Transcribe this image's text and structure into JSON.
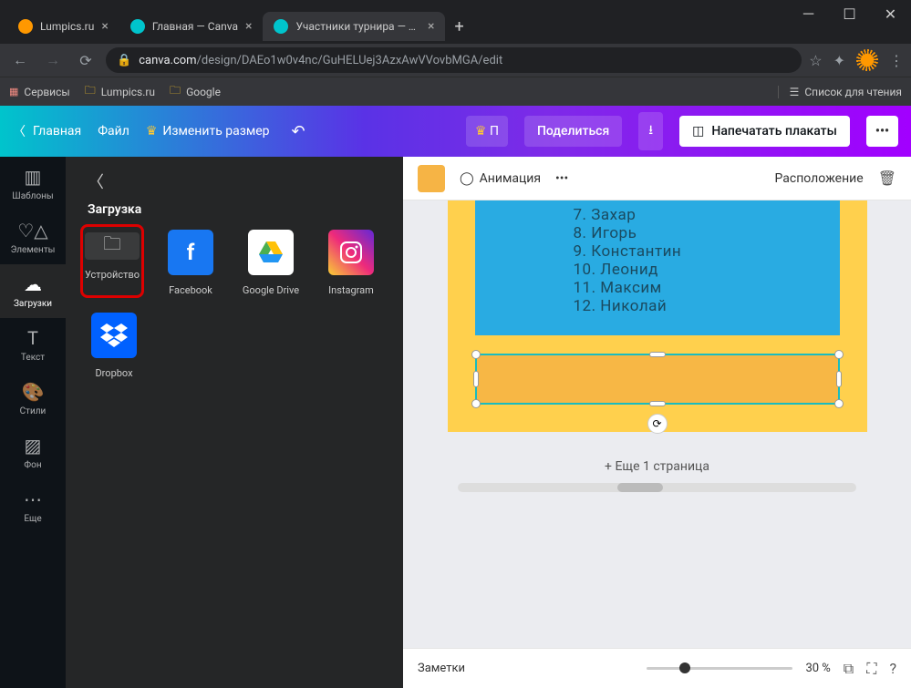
{
  "browser": {
    "tabs": [
      {
        "label": "Lumpics.ru",
        "favicon": "#ff9800"
      },
      {
        "label": "Главная — Canva",
        "favicon": "#00c4cc"
      },
      {
        "label": "Участники турнира — Плакат",
        "favicon": "#00c4cc"
      }
    ],
    "url_domain": "canva.com",
    "url_path": "/design/DAEo1w0v4nc/GuHELUej3AzxAwVVovbMGA/edit",
    "bookmarks": {
      "services": "Сервисы",
      "lumpics": "Lumpics.ru",
      "google": "Google",
      "reading_list": "Список для чтения"
    }
  },
  "top": {
    "home": "Главная",
    "file": "Файл",
    "resize": "Изменить размер",
    "trunc_publish": "П",
    "share": "Поделиться",
    "print": "Напечатать плакаты",
    "dots": "•••"
  },
  "sidebar": {
    "templates": "Шаблоны",
    "elements": "Элементы",
    "uploads": "Загрузки",
    "text": "Текст",
    "styles": "Стили",
    "background": "Фон",
    "more": "Еще"
  },
  "panel": {
    "title": "Загрузка",
    "device": "Устройство",
    "facebook": "Facebook",
    "gdrive": "Google Drive",
    "instagram": "Instagram",
    "dropbox": "Dropbox"
  },
  "context_toolbar": {
    "animation": "Анимация",
    "position": "Расположение"
  },
  "poster_list": [
    "7. Захар",
    "8. Игорь",
    "9. Константин",
    "10. Леонид",
    "11. Максим",
    "12. Николай"
  ],
  "add_page": "+ Еще 1 страница",
  "footer": {
    "notes": "Заметки",
    "zoom": "30 %"
  }
}
